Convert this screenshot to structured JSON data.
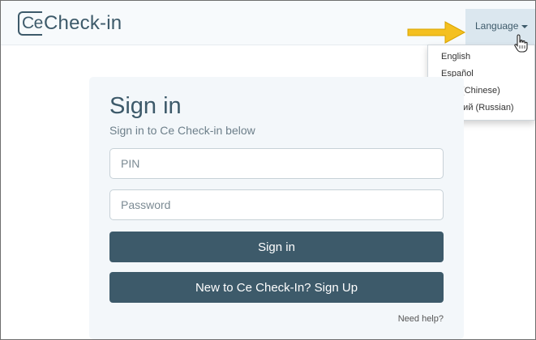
{
  "brand": {
    "mark": "Ce",
    "name": "Check-in"
  },
  "nav": {
    "language_label": "Language"
  },
  "language_menu": [
    "English",
    "Español",
    "中文 (Chinese)",
    "русский (Russian)"
  ],
  "signin": {
    "title": "Sign in",
    "subtitle": "Sign in to Ce Check-in below",
    "pin_placeholder": "PIN",
    "password_placeholder": "Password",
    "signin_button": "Sign in",
    "signup_button": "New to Ce Check-In? Sign Up",
    "help_link": "Need help?"
  },
  "colors": {
    "primary": "#3d5a6a",
    "navbar_bg": "#f7fafc",
    "card_bg": "#f3f7fa",
    "language_bg": "#dbe7ef",
    "annotation_arrow": "#f4c020"
  },
  "icons": [
    "caret-down-icon",
    "hand-pointer-icon",
    "annotation-arrow-icon"
  ]
}
